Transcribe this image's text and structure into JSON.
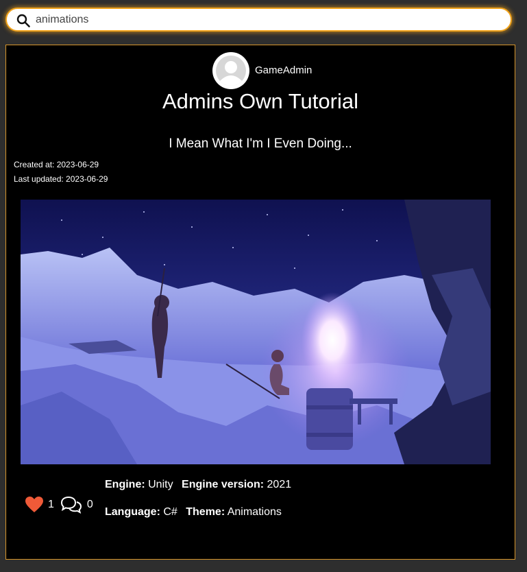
{
  "search": {
    "value": "animations",
    "icon": "search-icon"
  },
  "post": {
    "author": "GameAdmin",
    "title": "Admins Own Tutorial",
    "subtitle": "I Mean What I'm I Even Doing...",
    "created": "Created at: 2023-06-29",
    "updated": "Last updated: 2023-06-29",
    "likes": "1",
    "comments": "0",
    "meta": {
      "engine_label": "Engine:",
      "engine": "Unity",
      "engine_version_label": "Engine version:",
      "engine_version": "2021",
      "language_label": "Language:",
      "language": "C#",
      "theme_label": "Theme:",
      "theme": "Animations"
    }
  },
  "colors": {
    "accent": "#f0a21a",
    "heart": "#ef5a38",
    "card_bg": "#000000",
    "page_bg": "#2e2e2e"
  }
}
